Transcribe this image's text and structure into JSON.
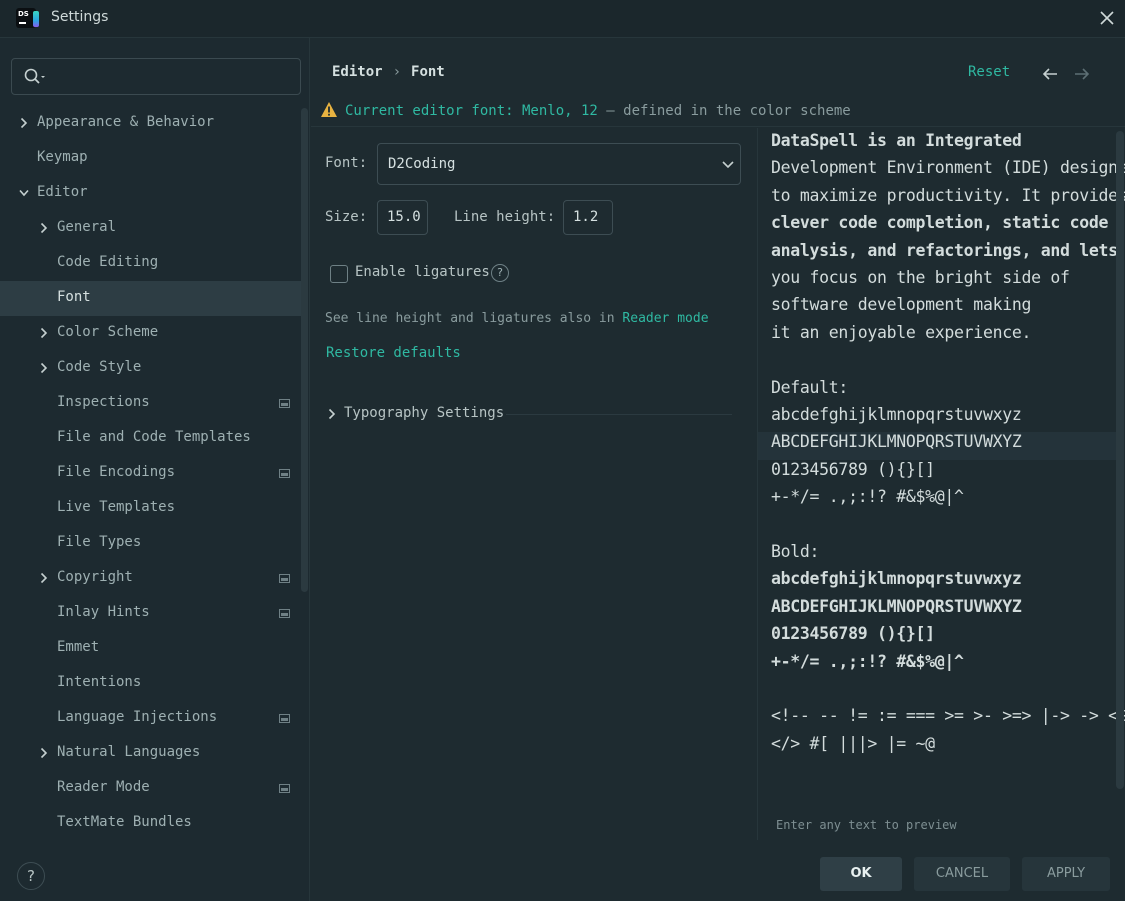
{
  "window": {
    "title": "Settings"
  },
  "search": {
    "placeholder": "",
    "value": ""
  },
  "sidebar": {
    "items": [
      {
        "label": "Appearance & Behavior",
        "chevron": "right"
      },
      {
        "label": "Keymap"
      },
      {
        "label": "Editor",
        "chevron": "down"
      },
      {
        "label": "General",
        "chevron": "right"
      },
      {
        "label": "Code Editing"
      },
      {
        "label": "Font",
        "selected": true
      },
      {
        "label": "Color Scheme",
        "chevron": "right"
      },
      {
        "label": "Code Style",
        "chevron": "right"
      },
      {
        "label": "Inspections",
        "project_icon": true
      },
      {
        "label": "File and Code Templates"
      },
      {
        "label": "File Encodings",
        "project_icon": true
      },
      {
        "label": "Live Templates"
      },
      {
        "label": "File Types"
      },
      {
        "label": "Copyright",
        "chevron": "right",
        "project_icon": true
      },
      {
        "label": "Inlay Hints",
        "project_icon": true
      },
      {
        "label": "Emmet"
      },
      {
        "label": "Intentions"
      },
      {
        "label": "Language Injections",
        "project_icon": true
      },
      {
        "label": "Natural Languages",
        "chevron": "right"
      },
      {
        "label": "Reader Mode",
        "project_icon": true
      },
      {
        "label": "TextMate Bundles"
      }
    ],
    "help_label": "?"
  },
  "header": {
    "breadcrumb": [
      "Editor",
      "Font"
    ],
    "breadcrumb_separator": "›",
    "reset_label": "Reset"
  },
  "warning": {
    "highlight": "Current editor font: Menlo, 12",
    "rest": " — defined in the color scheme"
  },
  "form": {
    "font_label": "Font:",
    "font_value": "D2Coding",
    "size_label": "Size:",
    "size_value": "15.0",
    "line_height_label": "Line height:",
    "line_height_value": "1.2",
    "ligatures_label": "Enable ligatures",
    "ligatures_checked": false,
    "ligatures_help": "?",
    "reader_hint": "See line height and ligatures also in ",
    "reader_link": "Reader mode",
    "restore_defaults": "Restore defaults",
    "typography_label": "Typography Settings"
  },
  "preview": {
    "lines": [
      "DataSpell is an Integrated",
      "Development Environment (IDE) designed",
      "to maximize productivity. It provides",
      "clever code completion, static code",
      "analysis, and refactorings, and lets",
      "you focus on the bright side of",
      "software development making",
      "it an enjoyable experience.",
      "",
      "Default:",
      "abcdefghijklmnopqrstuvwxyz",
      "ABCDEFGHIJKLMNOPQRSTUVWXYZ",
      " 0123456789 (){}[]",
      " +-*/= .,;:!? #&$%@|^",
      "",
      "Bold:",
      "abcdefghijklmnopqrstuvwxyz",
      "ABCDEFGHIJKLMNOPQRSTUVWXYZ",
      " 0123456789 (){}[]",
      " +-*/= .,;:!? #&$%@|^",
      "",
      "<!-- -- != := === >= >- >=> |-> -> <$>",
      "</> #[ |||> |= ~@"
    ],
    "hint": "Enter any text to preview"
  },
  "footer": {
    "ok_label": "OK",
    "cancel_label": "CANCEL",
    "apply_label": "APPLY"
  },
  "colors": {
    "accent": "#2fb9a2",
    "background": "#1e2b30",
    "selection": "#2d3d44",
    "warning": "#e8b341"
  }
}
